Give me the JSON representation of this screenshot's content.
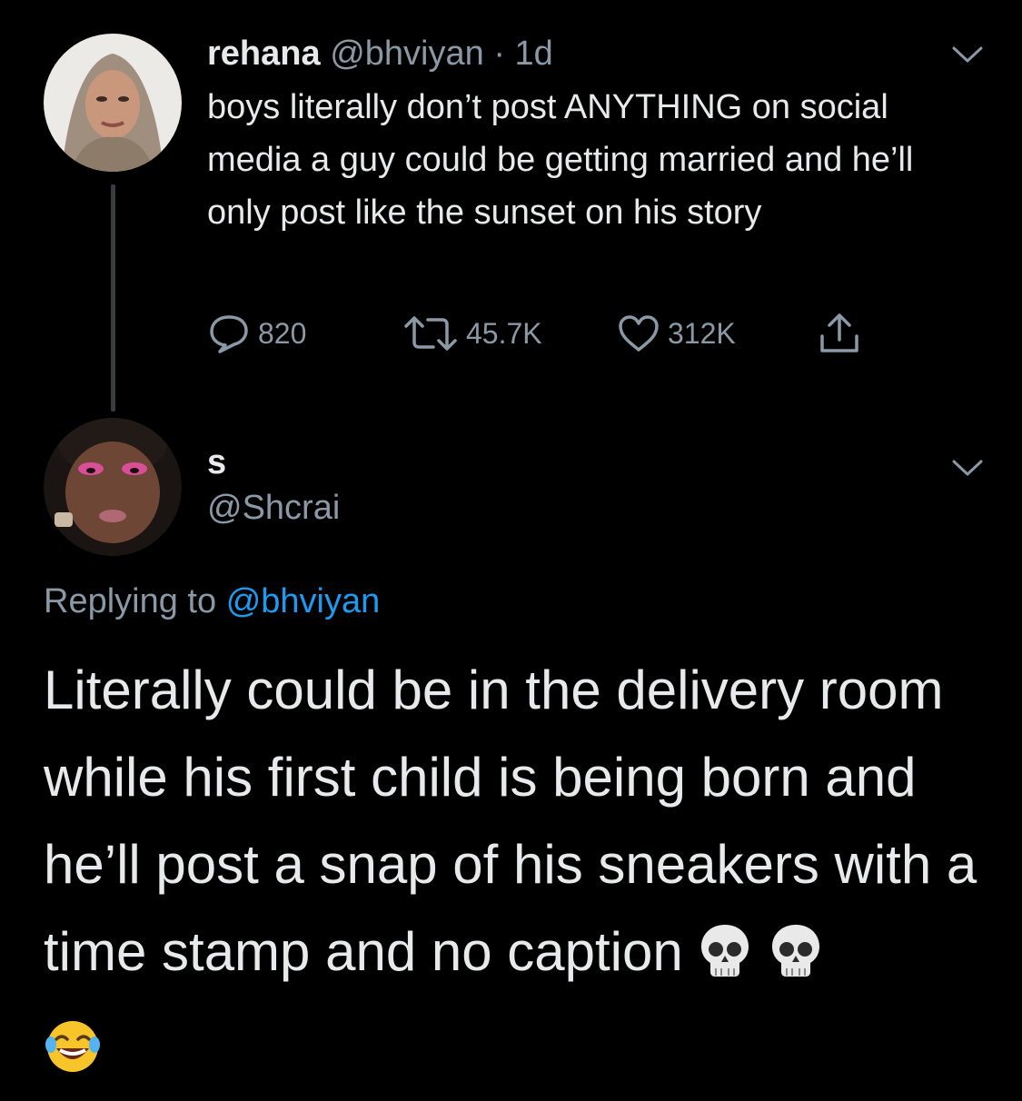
{
  "parent_tweet": {
    "name": "rehana",
    "handle": "@bhviyan",
    "time": "· 1d",
    "text": "boys literally don’t post ANYTHING on social media a guy could be getting married and he’ll only post like the sunset on his story",
    "reply_count": "820",
    "retweet_count": "45.7K",
    "like_count": "312K"
  },
  "reply_tweet": {
    "name": "s",
    "handle": "@Shcrai",
    "replying_prefix": "Replying to",
    "replying_handle": "@bhviyan",
    "text": "Literally could be in the delivery room while his first child is being born and he’ll post a snap of his sneakers with a time stamp and no caption",
    "emojis": [
      "skull-emoji",
      "skull-emoji",
      "joy-emoji"
    ]
  },
  "colors": {
    "background": "#000000",
    "text": "#e7e9ea",
    "muted": "#8b98a5",
    "link": "#1d9bf0",
    "thread_line": "#3a3d40"
  }
}
